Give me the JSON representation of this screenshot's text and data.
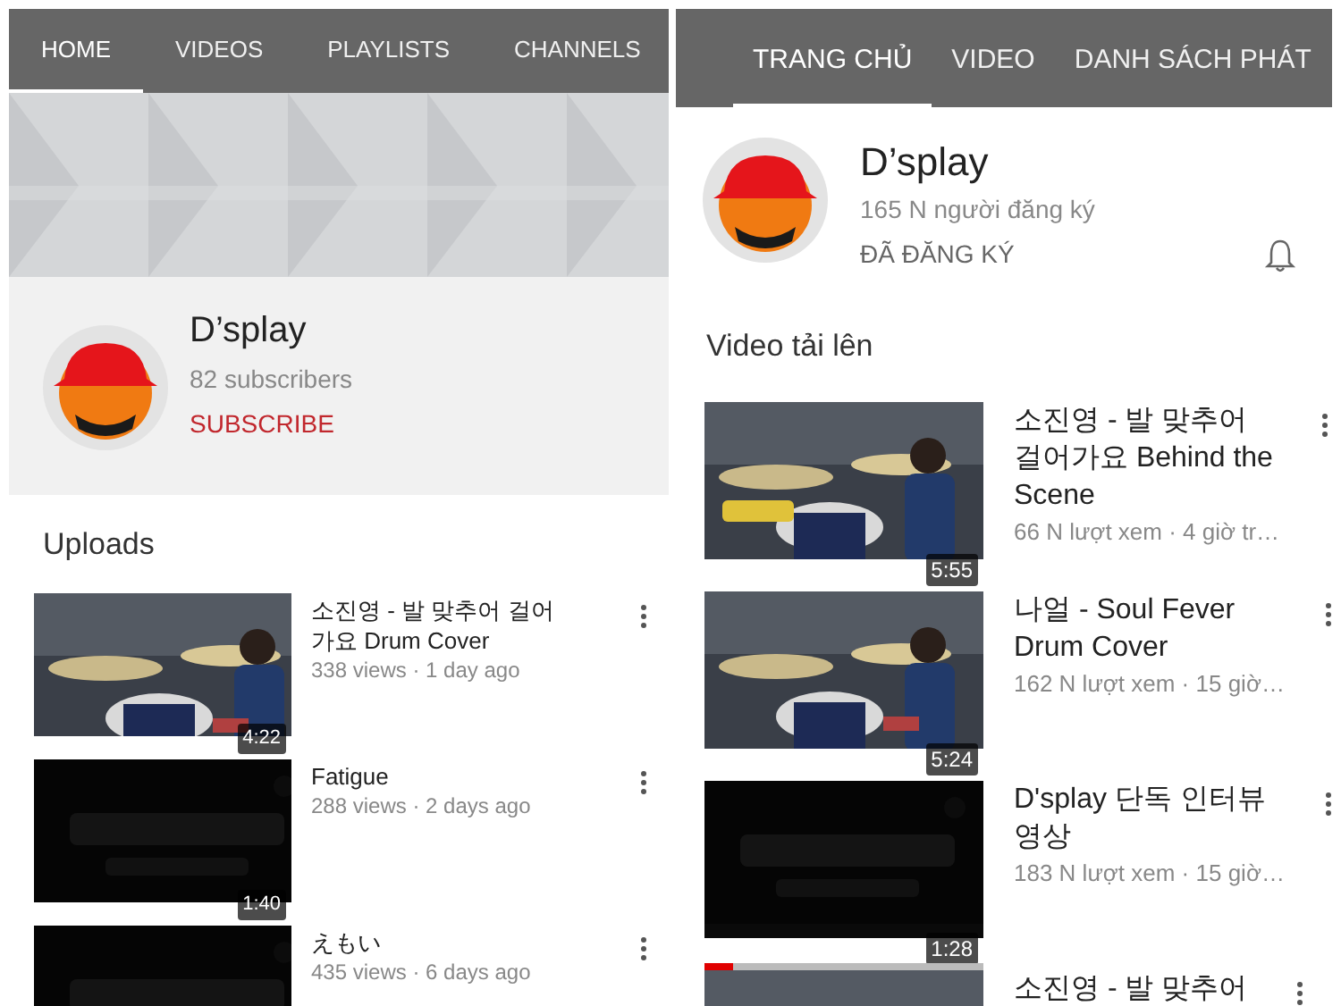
{
  "panels": [
    {
      "kind": "banner",
      "tabs": [
        {
          "label": "HOME",
          "selected": true
        },
        {
          "label": "VIDEOS",
          "selected": false
        },
        {
          "label": "PLAYLISTS",
          "selected": false
        },
        {
          "label": "CHANNELS",
          "selected": false
        }
      ],
      "channel": {
        "name": "D’splay",
        "subscribers": "82 subscribers",
        "subscribe_label": "SUBSCRIBE",
        "subscribed": false
      },
      "section_title": "Uploads",
      "videos": [
        {
          "title": "소진영 - 발 맞추어 걸어가요 Drum Cover",
          "meta": "338 views · 1 day ago",
          "duration": "4:22"
        },
        {
          "title": "Fatigue",
          "meta": "288 views · 2 days ago",
          "duration": "1:40"
        },
        {
          "title": "えもい",
          "meta": "435 views · 6 days ago"
        }
      ]
    },
    {
      "kind": "plain",
      "tabs": [
        {
          "label": "TRANG CHỦ",
          "selected": true
        },
        {
          "label": "VIDEO",
          "selected": false
        },
        {
          "label": "DANH SÁCH PHÁT",
          "selected": false
        }
      ],
      "channel": {
        "name": "D’splay",
        "subscribers": "165 N người đăng ký",
        "subscribe_label": "ĐÃ ĐĂNG KÝ",
        "subscribed": true
      },
      "section_title": "Video tải lên",
      "videos": [
        {
          "title": "소진영 - 발 맞추어 걸어가요 Behind the Scene",
          "meta": "66 N lượt xem · 4 giờ tr…",
          "duration": "5:55"
        },
        {
          "title": "나얼 - Soul Fever Drum Cover",
          "meta": "162 N lượt xem · 15 giờ…",
          "duration": "5:24"
        },
        {
          "title": "D'splay 단독 인터뷰 영상",
          "meta": "183 N lượt xem · 15 giờ…",
          "duration": "1:28",
          "level": 0.1
        },
        {
          "title": "소진영 - 발 맞추어"
        }
      ]
    }
  ]
}
